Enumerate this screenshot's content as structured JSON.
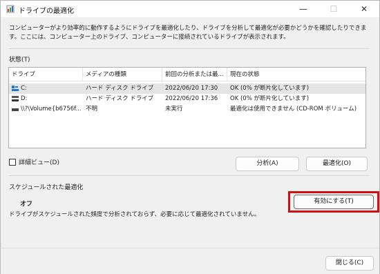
{
  "window": {
    "title": "ドライブの最適化",
    "minimize": "—",
    "maximize": "☐",
    "close": "✕"
  },
  "description": "コンピューターがより効率的に動作するようにドライブを最適化したり、ドライブを分析して最適化が必要かどうかを確認したりできます。ここには、コンピューター上のドライブ、コンピューターに接続されているドライブが表示されます。",
  "status": {
    "label": "状態(T)",
    "columns": [
      "ドライブ",
      "メディアの種類",
      "前回の分析または最...",
      "現在の状態"
    ],
    "drives": [
      {
        "drive": "C:",
        "media": "ハード ディスク ドライブ",
        "last": "2022/06/20 17:30",
        "state": "OK (0% が断片化しています)",
        "icon": "system-drive-icon",
        "selected": true
      },
      {
        "drive": "D:",
        "media": "ハード ディスク ドライブ",
        "last": "2022/06/20 17:36",
        "state": "OK (0% が断片化しています)",
        "icon": "hard-drive-icon",
        "selected": false
      },
      {
        "drive": "\\\\?\\Volume{b6756f...",
        "media": "不明",
        "last": "未実行",
        "state": "最適化は使用できません (CD-ROM ボリューム)",
        "icon": "volume-icon",
        "selected": false
      }
    ],
    "detail_view_label": "詳細ビュー(D)",
    "analyze_label": "分析(A)",
    "optimize_label": "最適化(O)"
  },
  "schedule": {
    "label": "スケジュールされた最適化",
    "state": "オフ",
    "description": "ドライブがスケジュールされた頻度で分析されておらず、必要に応じて最適化されていません。",
    "enable_label": "有効にする(T)"
  },
  "footer": {
    "close_label": "閉じる(C)"
  },
  "colors": {
    "highlight": "#d01010",
    "selection": "#e5e5e5"
  }
}
